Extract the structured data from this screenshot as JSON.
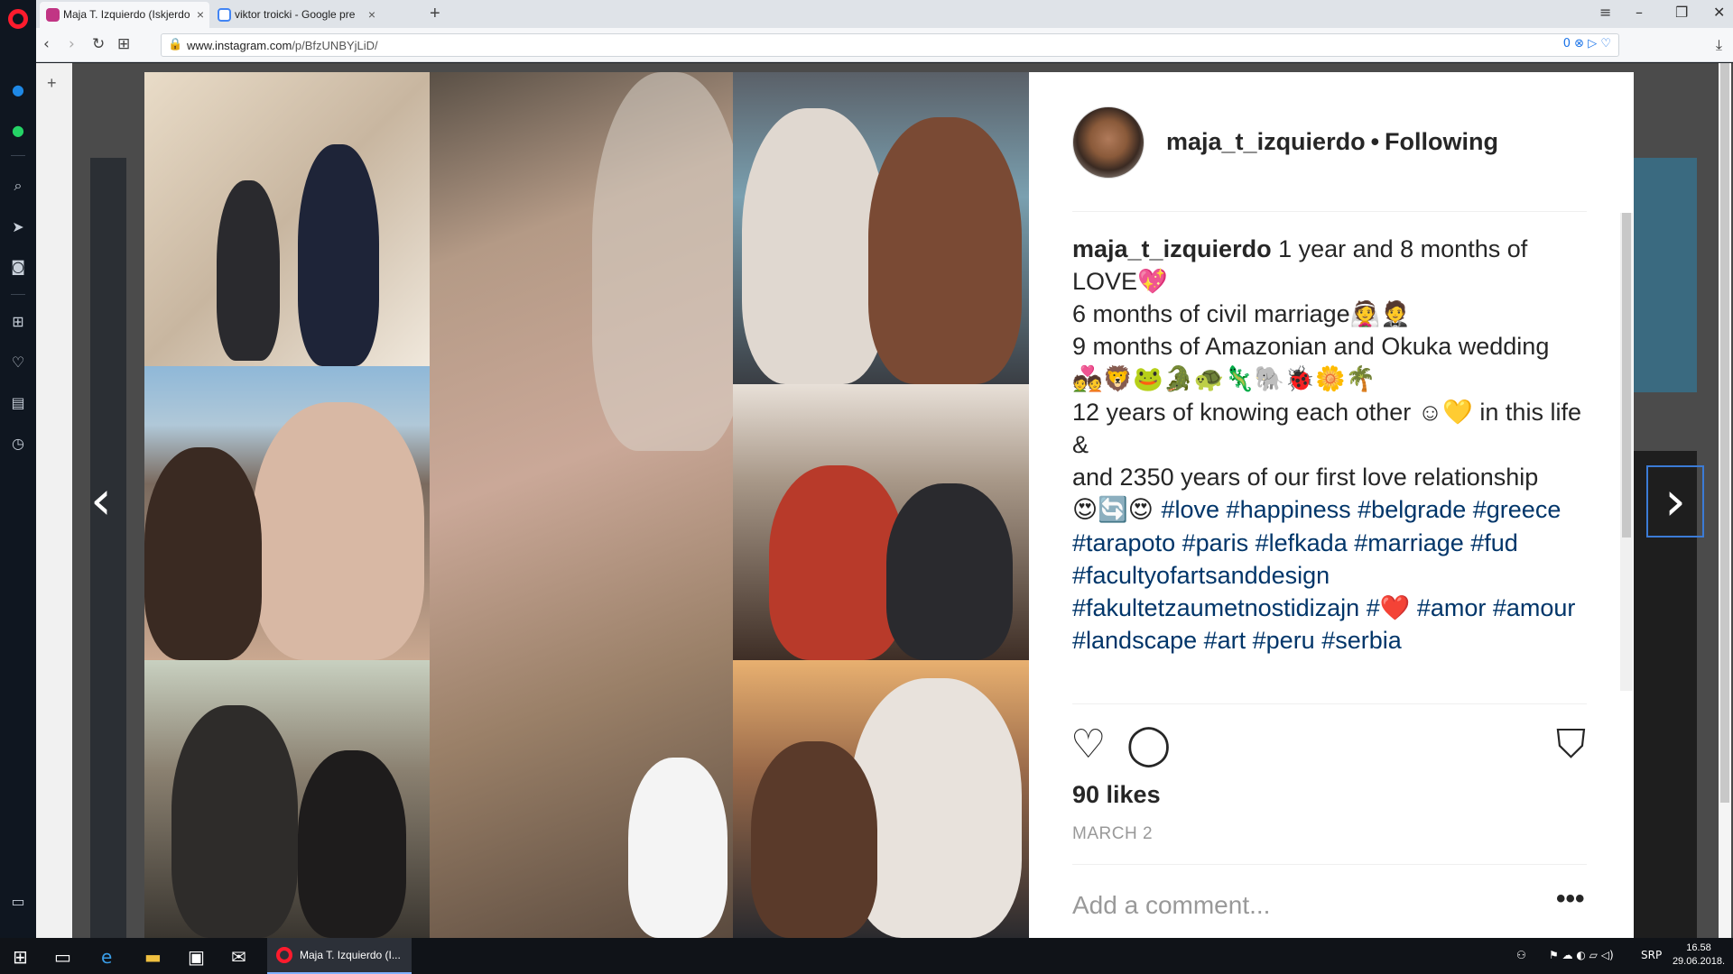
{
  "browser": {
    "tabs": [
      {
        "title": "Maja T. Izquierdo (Iskjerdo",
        "favicon_color": "#c13584",
        "active": true
      },
      {
        "title": "viktor troicki - Google pre",
        "favicon_color": "#4285f4",
        "active": false
      }
    ],
    "url_domain": "www.instagram.com",
    "url_path": "/p/BfzUNBYjLiD/",
    "url_right": "0"
  },
  "post": {
    "username": "maja_t_izquierdo",
    "separator": "•",
    "follow_status": "Following",
    "caption_user": "maja_t_izquierdo",
    "caption_lines": [
      " 1 year and 8 months of LOVE💖",
      "6 months of civil marriage👰🤵",
      "9 months of Amazonian and Okuka wedding",
      "💑🦁🐸🐊🐢🦎🐘🐞🌼🌴",
      "12 years of knowing each other ☺💛 in this life",
      "&",
      "and 2350 years of our first love relationship"
    ],
    "caption_emoji_line": "😍🔄😍 ",
    "hashtags": "#love #happiness #belgrade #greece #tarapoto #paris #lefkada #marriage #fud #facultyofartsanddesign #fakultetzaumetnostidizajn #❤️ #amor #amour #landscape #art #peru #serbia",
    "likes": "90 likes",
    "date": "MARCH 2",
    "comment_placeholder": "Add a comment...",
    "more": "•••"
  },
  "icons": {
    "heart": "♡",
    "comment": "◯",
    "bookmark": "⛉"
  },
  "taskbar": {
    "app_title": "Maja T. Izquierdo (I...",
    "lang": "SRP",
    "time": "16.58",
    "date": "29.06.2018."
  }
}
